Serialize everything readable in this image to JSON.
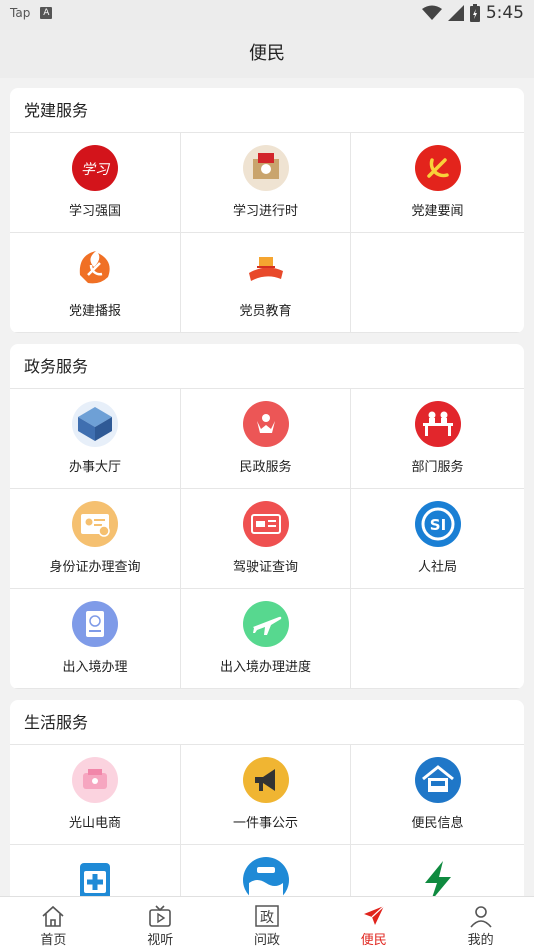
{
  "statusbar": {
    "app": "Tap",
    "badge": "A",
    "time": "5:45"
  },
  "header": {
    "title": "便民"
  },
  "sections": [
    {
      "title": "党建服务",
      "items": [
        {
          "label": "学习强国",
          "icon": "xuexi-qiangguo-icon",
          "color": "#d3141b"
        },
        {
          "label": "学习进行时",
          "icon": "xuexi-jinxingshi-icon",
          "color": "#d8b07a"
        },
        {
          "label": "党建要闻",
          "icon": "party-emblem-icon",
          "color": "#e3241c"
        },
        {
          "label": "党建播报",
          "icon": "party-broadcast-icon",
          "color": "#f07025"
        },
        {
          "label": "党员教育",
          "icon": "party-education-icon",
          "color": "#e8492a"
        }
      ]
    },
    {
      "title": "政务服务",
      "items": [
        {
          "label": "办事大厅",
          "icon": "service-hall-icon",
          "color": "#4d82c4"
        },
        {
          "label": "民政服务",
          "icon": "civil-affairs-icon",
          "color": "#ec5656"
        },
        {
          "label": "部门服务",
          "icon": "department-service-icon",
          "color": "#e2262c"
        },
        {
          "label": "身份证办理查询",
          "icon": "id-card-icon",
          "color": "#f5c070"
        },
        {
          "label": "驾驶证查询",
          "icon": "driver-license-icon",
          "color": "#ef5050"
        },
        {
          "label": "人社局",
          "icon": "social-security-icon",
          "color": "#1a7fd4"
        },
        {
          "label": "出入境办理",
          "icon": "passport-icon",
          "color": "#7f9be8"
        },
        {
          "label": "出入境办理进度",
          "icon": "airplane-icon",
          "color": "#57d88f"
        }
      ]
    },
    {
      "title": "生活服务",
      "items": [
        {
          "label": "光山电商",
          "icon": "ecommerce-icon",
          "color": "#f6a6c0"
        },
        {
          "label": "一件事公示",
          "icon": "megaphone-icon",
          "color": "#f0b532"
        },
        {
          "label": "便民信息",
          "icon": "house-info-icon",
          "color": "#1f77c8"
        },
        {
          "label": "",
          "icon": "medical-icon",
          "color": "#1f8ad6"
        },
        {
          "label": "",
          "icon": "water-icon",
          "color": "#1f8ad6"
        },
        {
          "label": "",
          "icon": "lightning-icon",
          "color": "#0f8a3f"
        }
      ]
    }
  ],
  "tabs": [
    {
      "label": "首页",
      "icon": "home-icon"
    },
    {
      "label": "视听",
      "icon": "tv-play-icon"
    },
    {
      "label": "问政",
      "icon": "zheng-box-icon"
    },
    {
      "label": "便民",
      "icon": "paper-plane-icon",
      "active": true
    },
    {
      "label": "我的",
      "icon": "user-icon"
    }
  ],
  "colors": {
    "accent": "#e0231c",
    "background": "#f2f2f2"
  }
}
